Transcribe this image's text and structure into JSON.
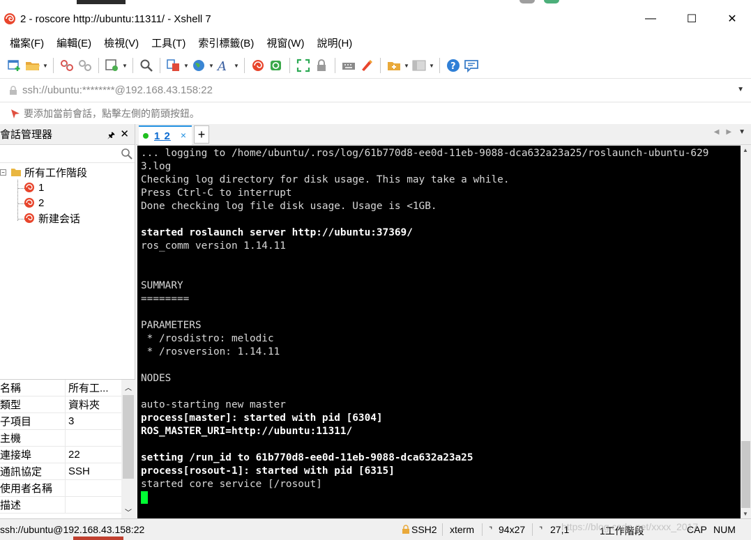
{
  "window": {
    "title": "2 - roscore http://ubuntu:11311/ - Xshell 7",
    "minimize": "—",
    "maximize": "☐",
    "close": "✕"
  },
  "menu": [
    "檔案(F)",
    "編輯(E)",
    "檢視(V)",
    "工具(T)",
    "索引標籤(B)",
    "視窗(W)",
    "說明(H)"
  ],
  "address": {
    "value": "ssh://ubuntu:********@192.168.43.158:22"
  },
  "hint": "要添加當前會話，點擊左側的箭頭按鈕。",
  "session_manager": {
    "title": "會話管理器",
    "root": "所有工作階段",
    "items": [
      "1",
      "2",
      "新建会话"
    ]
  },
  "properties": {
    "rows": [
      {
        "k": "名稱",
        "v": "所有工..."
      },
      {
        "k": "類型",
        "v": "資料夾"
      },
      {
        "k": "子項目",
        "v": "3"
      },
      {
        "k": "主機",
        "v": ""
      },
      {
        "k": "連接埠",
        "v": "22"
      },
      {
        "k": "通訊協定",
        "v": "SSH"
      },
      {
        "k": "使用者名稱",
        "v": ""
      },
      {
        "k": "描述",
        "v": ""
      }
    ]
  },
  "tabs": [
    {
      "label": "1 2",
      "close": "×"
    }
  ],
  "tab_add": "+",
  "terminal": {
    "lines": [
      {
        "text": "... logging to /home/ubuntu/.ros/log/61b770d8-ee0d-11eb-9088-dca632a23a25/roslaunch-ubuntu-629",
        "bold": false
      },
      {
        "text": "3.log",
        "bold": false
      },
      {
        "text": "Checking log directory for disk usage. This may take a while.",
        "bold": false
      },
      {
        "text": "Press Ctrl-C to interrupt",
        "bold": false
      },
      {
        "text": "Done checking log file disk usage. Usage is <1GB.",
        "bold": false
      },
      {
        "text": "",
        "bold": false
      },
      {
        "text": "started roslaunch server http://ubuntu:37369/",
        "bold": true
      },
      {
        "text": "ros_comm version 1.14.11",
        "bold": false
      },
      {
        "text": "",
        "bold": false
      },
      {
        "text": "",
        "bold": false
      },
      {
        "text": "SUMMARY",
        "bold": false
      },
      {
        "text": "========",
        "bold": false
      },
      {
        "text": "",
        "bold": false
      },
      {
        "text": "PARAMETERS",
        "bold": false
      },
      {
        "text": " * /rosdistro: melodic",
        "bold": false
      },
      {
        "text": " * /rosversion: 1.14.11",
        "bold": false
      },
      {
        "text": "",
        "bold": false
      },
      {
        "text": "NODES",
        "bold": false
      },
      {
        "text": "",
        "bold": false
      },
      {
        "text": "auto-starting new master",
        "bold": false
      },
      {
        "text": "process[master]: started with pid [6304]",
        "bold": true
      },
      {
        "text": "ROS_MASTER_URI=http://ubuntu:11311/",
        "bold": true
      },
      {
        "text": "",
        "bold": false
      },
      {
        "text": "setting /run_id to 61b770d8-ee0d-11eb-9088-dca632a23a25",
        "bold": true
      },
      {
        "text": "process[rosout-1]: started with pid [6315]",
        "bold": true
      },
      {
        "text": "started core service [/rosout]",
        "bold": false
      }
    ]
  },
  "status": {
    "connection": "ssh://ubuntu@192.168.43.158:22",
    "protocol": "SSH2",
    "term": "xterm",
    "size": "94x27",
    "cursor": "27,1",
    "sessions": "1工作階段",
    "caps": "CAP",
    "num": "NUM"
  },
  "watermark": "https://blog.csdn.net/xxxx_2017",
  "colors": {
    "accent": "#1f8fe0",
    "cursor": "#00ff33",
    "terminal_bg": "#000000"
  }
}
